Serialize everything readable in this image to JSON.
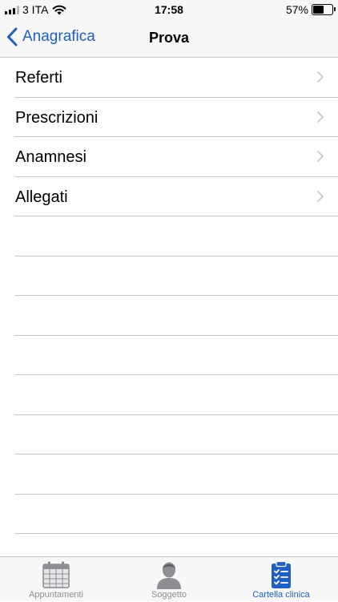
{
  "status_bar": {
    "carrier": "3 ITA",
    "time": "17:58",
    "battery_percent": "57%",
    "battery_level": 0.57,
    "signal_bars_active": 3
  },
  "nav": {
    "back_label": "Anagrafica",
    "title": "Prova"
  },
  "list": {
    "items": [
      {
        "label": "Referti"
      },
      {
        "label": "Prescrizioni"
      },
      {
        "label": "Anamnesi"
      },
      {
        "label": "Allegati"
      }
    ],
    "empty_rows": 9
  },
  "tab_bar": {
    "tabs": [
      {
        "label": "Appuntamenti",
        "icon": "calendar-icon",
        "active": false
      },
      {
        "label": "Soggetto",
        "icon": "person-icon",
        "active": false
      },
      {
        "label": "Cartella clinica",
        "icon": "clipboard-checklist-icon",
        "active": true
      }
    ]
  },
  "colors": {
    "accent": "#1f5fc5",
    "inactive_tab": "#8e8e93",
    "separator": "#c8c7cc",
    "bar_background": "#f7f7f7"
  }
}
